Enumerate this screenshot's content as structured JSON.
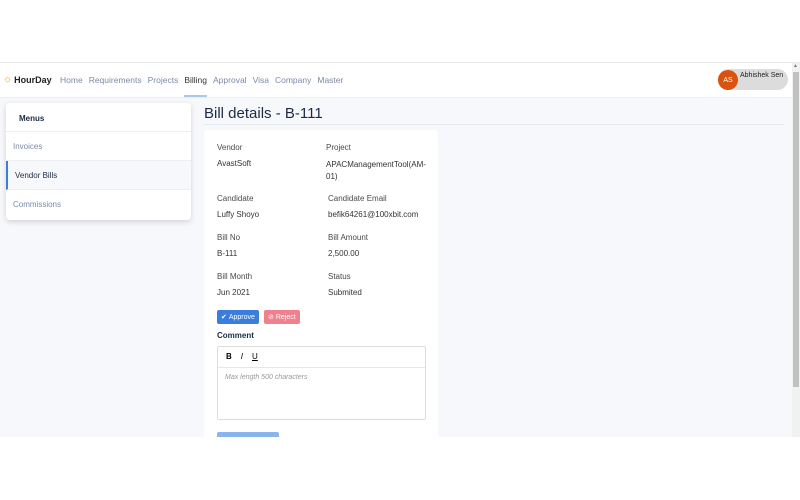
{
  "nav": {
    "brand": "HourDay",
    "links": [
      "Home",
      "Requirements",
      "Projects",
      "Billing",
      "Approval",
      "Visa",
      "Company",
      "Master"
    ],
    "active": "Billing"
  },
  "user": {
    "initials": "AS",
    "name": "Abhishek Sen"
  },
  "menu": {
    "title": "Menus",
    "items": [
      "Invoices",
      "Vendor Bills",
      "Commissions"
    ],
    "active": "Vendor Bills"
  },
  "page": {
    "title": "Bill details - B-111"
  },
  "bill": {
    "vendor_label": "Vendor",
    "vendor": "AvastSoft",
    "project_label": "Project",
    "project": "APACManagementTool(AM-01)",
    "candidate_label": "Candidate",
    "candidate": "Luffy Shoyo",
    "email_label": "Candidate Email",
    "email": "befik64261@100xbit.com",
    "billno_label": "Bill No",
    "billno": "B-111",
    "amount_label": "Bill Amount",
    "amount": "2,500.00",
    "month_label": "Bill Month",
    "month": "Jun 2021",
    "status_label": "Status",
    "status": "Submited"
  },
  "actions": {
    "approve": "Approve",
    "reject": "Reject"
  },
  "comment": {
    "label": "Comment",
    "bold": "B",
    "italic": "I",
    "underline": "U",
    "placeholder": "Max length 500 characters"
  },
  "colors": {
    "primary": "#3b7ddd",
    "danger": "#f0808e",
    "avatar": "#d9530e"
  }
}
